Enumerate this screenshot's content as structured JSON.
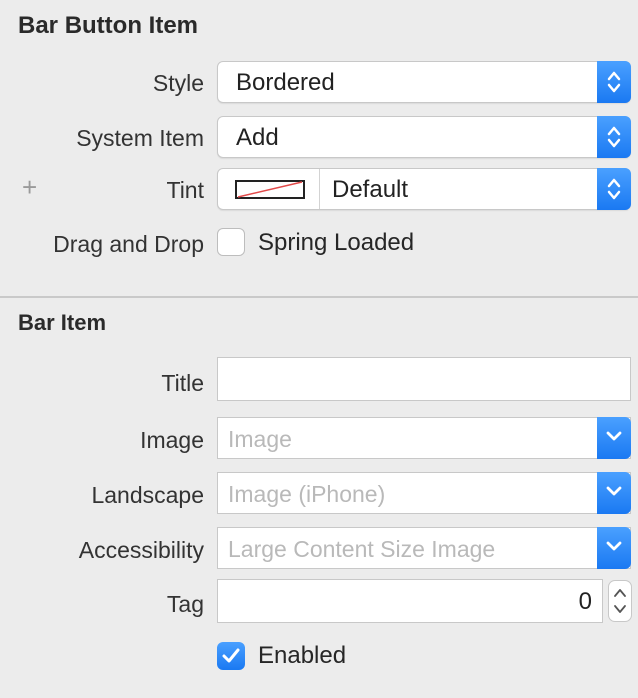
{
  "bar_button_item": {
    "title": "Bar Button Item",
    "style": {
      "label": "Style",
      "value": "Bordered"
    },
    "system_item": {
      "label": "System Item",
      "value": "Add"
    },
    "tint": {
      "label": "Tint",
      "value": "Default",
      "add_symbol": "+"
    },
    "drag_and_drop": {
      "label": "Drag and Drop",
      "checkbox_label": "Spring Loaded",
      "checked": false
    }
  },
  "bar_item": {
    "title": "Bar Item",
    "title_field": {
      "label": "Title",
      "value": ""
    },
    "image": {
      "label": "Image",
      "placeholder": "Image"
    },
    "landscape": {
      "label": "Landscape",
      "placeholder": "Image (iPhone)"
    },
    "accessibility": {
      "label": "Accessibility",
      "placeholder": "Large Content Size Image"
    },
    "tag": {
      "label": "Tag",
      "value": "0"
    },
    "enabled": {
      "label": "Enabled",
      "checked": true
    }
  },
  "colors": {
    "accent": "#1a79f2",
    "panel_bg": "#ececec"
  },
  "icons": [
    "up-down-chevron-icon",
    "chevron-down-icon",
    "checkmark-icon",
    "plus-icon",
    "color-swatch-none-icon"
  ]
}
